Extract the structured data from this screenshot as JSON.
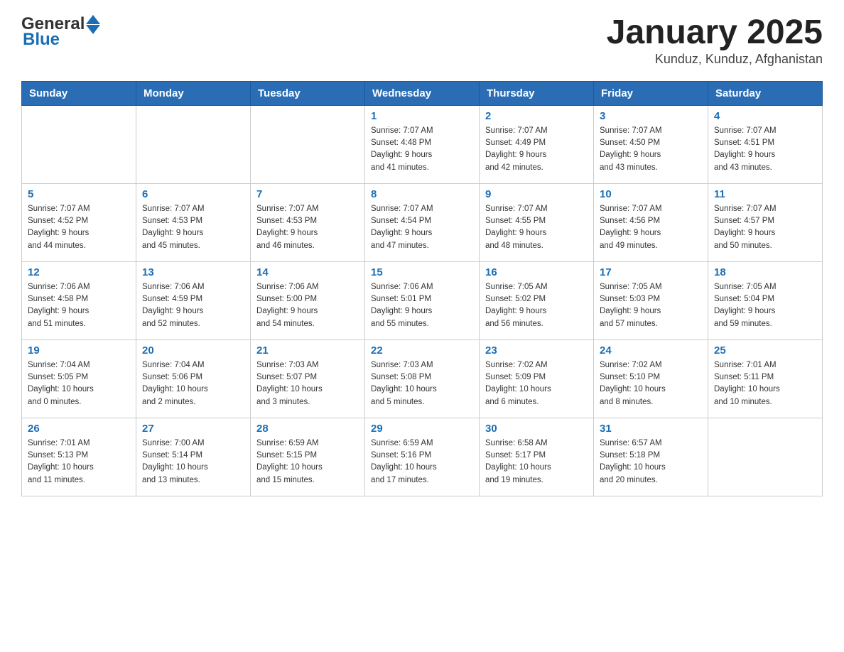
{
  "header": {
    "logo_general": "General",
    "logo_blue": "Blue",
    "title": "January 2025",
    "subtitle": "Kunduz, Kunduz, Afghanistan"
  },
  "days": [
    "Sunday",
    "Monday",
    "Tuesday",
    "Wednesday",
    "Thursday",
    "Friday",
    "Saturday"
  ],
  "weeks": [
    [
      {
        "date": "",
        "info": ""
      },
      {
        "date": "",
        "info": ""
      },
      {
        "date": "",
        "info": ""
      },
      {
        "date": "1",
        "info": "Sunrise: 7:07 AM\nSunset: 4:48 PM\nDaylight: 9 hours\nand 41 minutes."
      },
      {
        "date": "2",
        "info": "Sunrise: 7:07 AM\nSunset: 4:49 PM\nDaylight: 9 hours\nand 42 minutes."
      },
      {
        "date": "3",
        "info": "Sunrise: 7:07 AM\nSunset: 4:50 PM\nDaylight: 9 hours\nand 43 minutes."
      },
      {
        "date": "4",
        "info": "Sunrise: 7:07 AM\nSunset: 4:51 PM\nDaylight: 9 hours\nand 43 minutes."
      }
    ],
    [
      {
        "date": "5",
        "info": "Sunrise: 7:07 AM\nSunset: 4:52 PM\nDaylight: 9 hours\nand 44 minutes."
      },
      {
        "date": "6",
        "info": "Sunrise: 7:07 AM\nSunset: 4:53 PM\nDaylight: 9 hours\nand 45 minutes."
      },
      {
        "date": "7",
        "info": "Sunrise: 7:07 AM\nSunset: 4:53 PM\nDaylight: 9 hours\nand 46 minutes."
      },
      {
        "date": "8",
        "info": "Sunrise: 7:07 AM\nSunset: 4:54 PM\nDaylight: 9 hours\nand 47 minutes."
      },
      {
        "date": "9",
        "info": "Sunrise: 7:07 AM\nSunset: 4:55 PM\nDaylight: 9 hours\nand 48 minutes."
      },
      {
        "date": "10",
        "info": "Sunrise: 7:07 AM\nSunset: 4:56 PM\nDaylight: 9 hours\nand 49 minutes."
      },
      {
        "date": "11",
        "info": "Sunrise: 7:07 AM\nSunset: 4:57 PM\nDaylight: 9 hours\nand 50 minutes."
      }
    ],
    [
      {
        "date": "12",
        "info": "Sunrise: 7:06 AM\nSunset: 4:58 PM\nDaylight: 9 hours\nand 51 minutes."
      },
      {
        "date": "13",
        "info": "Sunrise: 7:06 AM\nSunset: 4:59 PM\nDaylight: 9 hours\nand 52 minutes."
      },
      {
        "date": "14",
        "info": "Sunrise: 7:06 AM\nSunset: 5:00 PM\nDaylight: 9 hours\nand 54 minutes."
      },
      {
        "date": "15",
        "info": "Sunrise: 7:06 AM\nSunset: 5:01 PM\nDaylight: 9 hours\nand 55 minutes."
      },
      {
        "date": "16",
        "info": "Sunrise: 7:05 AM\nSunset: 5:02 PM\nDaylight: 9 hours\nand 56 minutes."
      },
      {
        "date": "17",
        "info": "Sunrise: 7:05 AM\nSunset: 5:03 PM\nDaylight: 9 hours\nand 57 minutes."
      },
      {
        "date": "18",
        "info": "Sunrise: 7:05 AM\nSunset: 5:04 PM\nDaylight: 9 hours\nand 59 minutes."
      }
    ],
    [
      {
        "date": "19",
        "info": "Sunrise: 7:04 AM\nSunset: 5:05 PM\nDaylight: 10 hours\nand 0 minutes."
      },
      {
        "date": "20",
        "info": "Sunrise: 7:04 AM\nSunset: 5:06 PM\nDaylight: 10 hours\nand 2 minutes."
      },
      {
        "date": "21",
        "info": "Sunrise: 7:03 AM\nSunset: 5:07 PM\nDaylight: 10 hours\nand 3 minutes."
      },
      {
        "date": "22",
        "info": "Sunrise: 7:03 AM\nSunset: 5:08 PM\nDaylight: 10 hours\nand 5 minutes."
      },
      {
        "date": "23",
        "info": "Sunrise: 7:02 AM\nSunset: 5:09 PM\nDaylight: 10 hours\nand 6 minutes."
      },
      {
        "date": "24",
        "info": "Sunrise: 7:02 AM\nSunset: 5:10 PM\nDaylight: 10 hours\nand 8 minutes."
      },
      {
        "date": "25",
        "info": "Sunrise: 7:01 AM\nSunset: 5:11 PM\nDaylight: 10 hours\nand 10 minutes."
      }
    ],
    [
      {
        "date": "26",
        "info": "Sunrise: 7:01 AM\nSunset: 5:13 PM\nDaylight: 10 hours\nand 11 minutes."
      },
      {
        "date": "27",
        "info": "Sunrise: 7:00 AM\nSunset: 5:14 PM\nDaylight: 10 hours\nand 13 minutes."
      },
      {
        "date": "28",
        "info": "Sunrise: 6:59 AM\nSunset: 5:15 PM\nDaylight: 10 hours\nand 15 minutes."
      },
      {
        "date": "29",
        "info": "Sunrise: 6:59 AM\nSunset: 5:16 PM\nDaylight: 10 hours\nand 17 minutes."
      },
      {
        "date": "30",
        "info": "Sunrise: 6:58 AM\nSunset: 5:17 PM\nDaylight: 10 hours\nand 19 minutes."
      },
      {
        "date": "31",
        "info": "Sunrise: 6:57 AM\nSunset: 5:18 PM\nDaylight: 10 hours\nand 20 minutes."
      },
      {
        "date": "",
        "info": ""
      }
    ]
  ]
}
